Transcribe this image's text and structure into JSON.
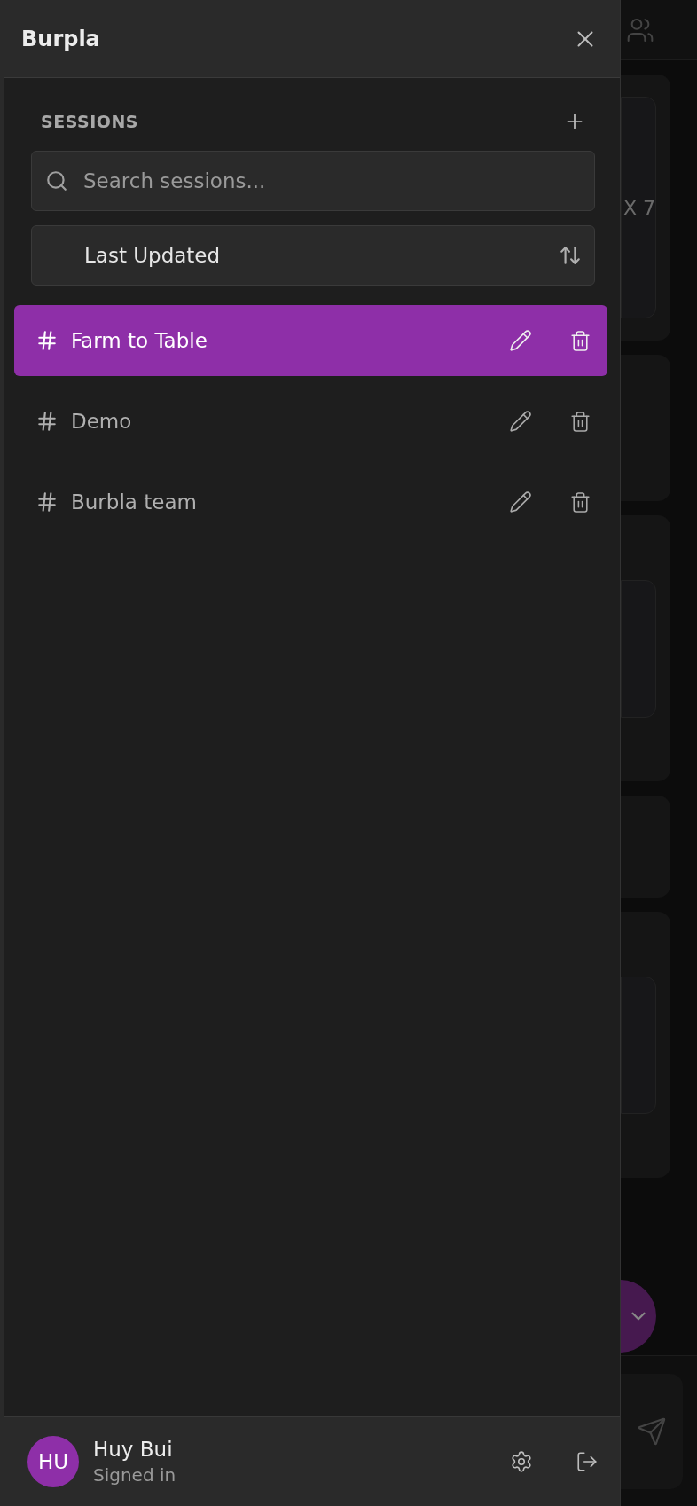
{
  "drawer": {
    "title": "Burpla"
  },
  "sessions": {
    "heading": "SESSIONS",
    "search": {
      "placeholder": "Search sessions..."
    },
    "sort": {
      "label": "Last Updated"
    },
    "items": [
      {
        "name": "Farm to Table",
        "selected": true
      },
      {
        "name": "Demo",
        "selected": false
      },
      {
        "name": "Burbla team",
        "selected": false
      }
    ]
  },
  "user": {
    "initials": "HU",
    "name": "Huy Bui",
    "status": "Signed in"
  },
  "background": {
    "card_text": "X 7"
  }
}
